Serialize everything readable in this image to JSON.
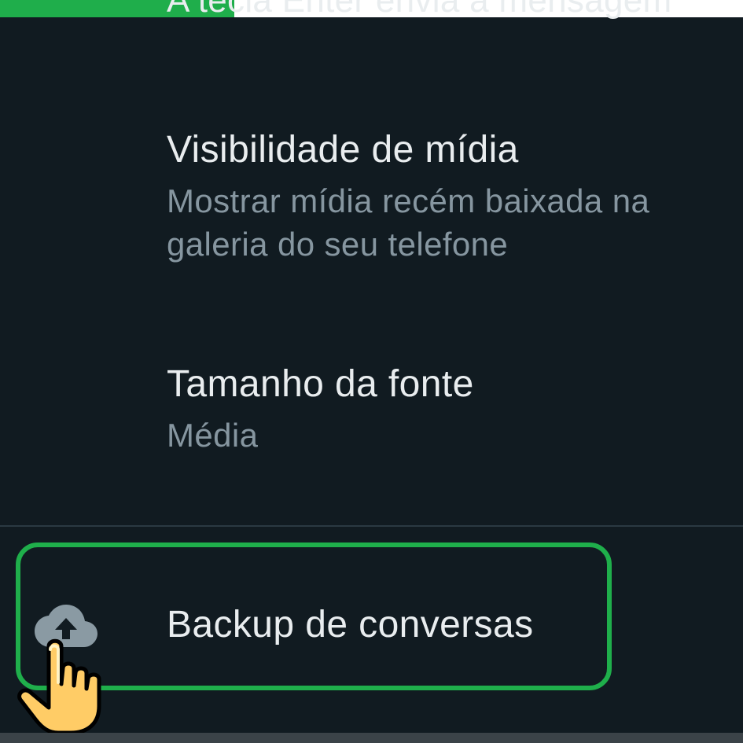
{
  "progress": {
    "fraction": 0.315,
    "color": "#1fae4b"
  },
  "cutoff_item": {
    "subtitle": "A tecla Enter envia a mensagem"
  },
  "settings": {
    "media_visibility": {
      "title": "Visibilidade de mídia",
      "subtitle": "Mostrar mídia recém baixada na galeria do seu telefone"
    },
    "font_size": {
      "title": "Tamanho da fonte",
      "subtitle": "Média"
    }
  },
  "backup": {
    "label": "Backup de conversas",
    "icon": "cloud-upload-icon"
  },
  "overlay": {
    "highlight_color": "#1faf4b",
    "pointer_icon": "hand-pointer-icon"
  },
  "colors": {
    "background": "#111b21",
    "title_text": "#e9edef",
    "subtitle_text": "#8696a0"
  }
}
